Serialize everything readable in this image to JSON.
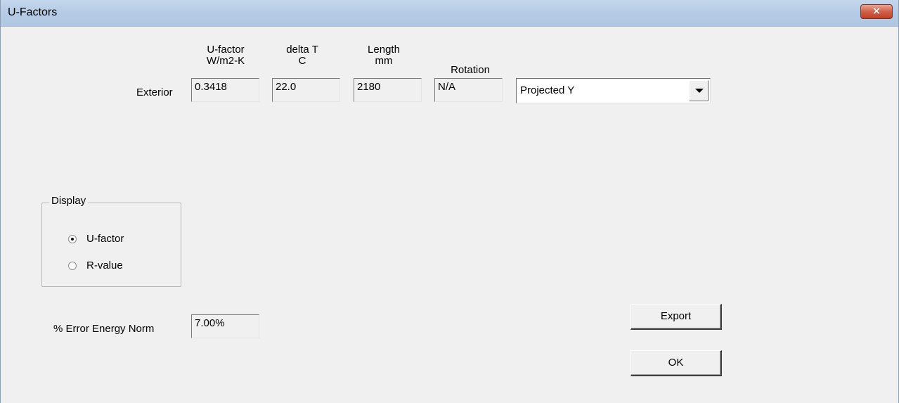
{
  "window": {
    "title": "U-Factors",
    "close_label": "✕"
  },
  "columns": {
    "ufactor": {
      "line1": "U-factor",
      "line2": "W/m2-K"
    },
    "delta_t": {
      "line1": "delta T",
      "line2": "C"
    },
    "length": {
      "line1": "Length",
      "line2": "mm"
    },
    "rotation": {
      "line1": "Rotation"
    }
  },
  "exterior": {
    "label": "Exterior",
    "ufactor": "0.3418",
    "delta_t": "22.0",
    "length": "2180",
    "rotation": "N/A",
    "projection": "Projected Y"
  },
  "display": {
    "title": "Display",
    "options": [
      {
        "label": "U-factor",
        "checked": true
      },
      {
        "label": "R-value",
        "checked": false
      }
    ]
  },
  "error_norm": {
    "label": "% Error Energy Norm",
    "value": "7.00%"
  },
  "buttons": {
    "export": "Export",
    "ok": "OK"
  }
}
